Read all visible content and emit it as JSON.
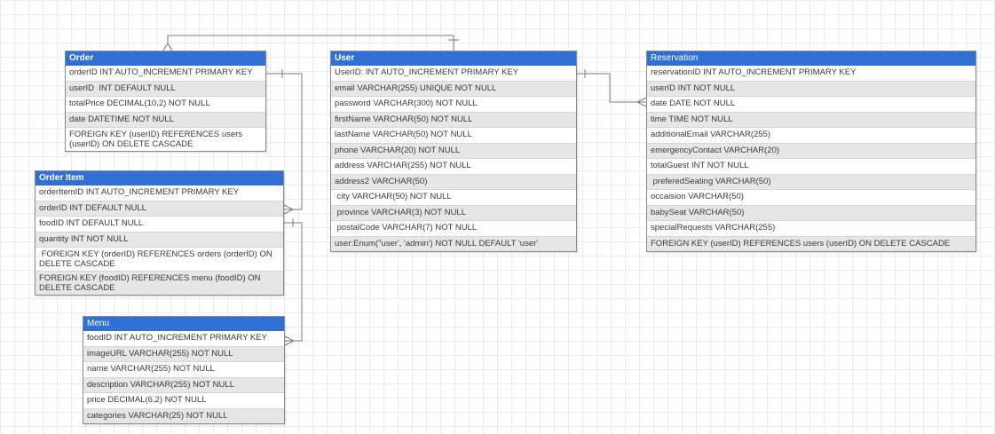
{
  "colors": {
    "header": "#2f6fd6",
    "row_alt": "#e6e6e6",
    "border": "#8a8a8a",
    "connector": "#7a7a7a"
  },
  "entities": {
    "order": {
      "title": "Order",
      "rows": [
        "orderID INT AUTO_INCREMENT PRIMARY KEY",
        "userID  INT DEFAULT NULL",
        "totalPrice DECIMAL(10,2) NOT NULL",
        "date DATETIME NOT NULL",
        "FOREIGN KEY (userID) REFERENCES users (userID) ON DELETE CASCADE"
      ]
    },
    "order_item": {
      "title": "Order Item",
      "rows": [
        "orderItemID INT AUTO_INCREMENT PRIMARY KEY",
        "orderID INT DEFAULT NULL",
        "foodID INT DEFAULT NULL",
        "quantity INT NOT NULL",
        " FOREIGN KEY (orderID) REFERENCES orders (orderID) ON DELETE CASCADE",
        "FOREIGN KEY (foodID) REFERENCES menu (foodID) ON DELETE CASCADE"
      ]
    },
    "menu": {
      "title": "Menu",
      "rows": [
        "foodID INT AUTO_INCREMENT PRIMARY KEY",
        "imageURL VARCHAR(255) NOT NULL",
        "name VARCHAR(255) NOT NULL",
        "description VARCHAR(255) NOT NULL",
        "price DECIMAL(6,2) NOT NULL",
        "categories VARCHAR(25) NOT NULL"
      ]
    },
    "user": {
      "title": "User",
      "rows": [
        "UserID: INT AUTO_INCREMENT PRIMARY KEY",
        "email VARCHAR(255) UNIQUE NOT NULL",
        "password VARCHAR(300) NOT NULL",
        "firstName VARCHAR(50) NOT NULL",
        "lastName VARCHAR(50) NOT NULL",
        "phone VARCHAR(20) NOT NULL",
        "address VARCHAR(255) NOT NULL",
        "address2 VARCHAR(50)",
        " city VARCHAR(50) NOT NULL",
        " province VARCHAR(3) NOT NULL",
        " postalCode VARCHAR(7) NOT NULL",
        "user:Enum(\"user', 'admin') NOT NULL DEFAULT 'user'"
      ]
    },
    "reservation": {
      "title": "Reservation",
      "rows": [
        "reservationID INT AUTO_INCREMENT PRIMARY KEY",
        "userID INT NOT NULL",
        "date DATE NOT NULL",
        "time TIME NOT NULL",
        "additionalEmail VARCHAR(255)",
        "emergencyContact VARCHAR(20)",
        "totalGuest INT NOT NULL",
        " preferedSeating VARCHAR(50)",
        "occaision VARCHAR(50)",
        "babySeat VARCHAR(50)",
        "specialRequests VARCHAR(255)",
        "FOREIGN KEY (userID) REFERENCES users (userID) ON DELETE CASCADE"
      ]
    }
  }
}
